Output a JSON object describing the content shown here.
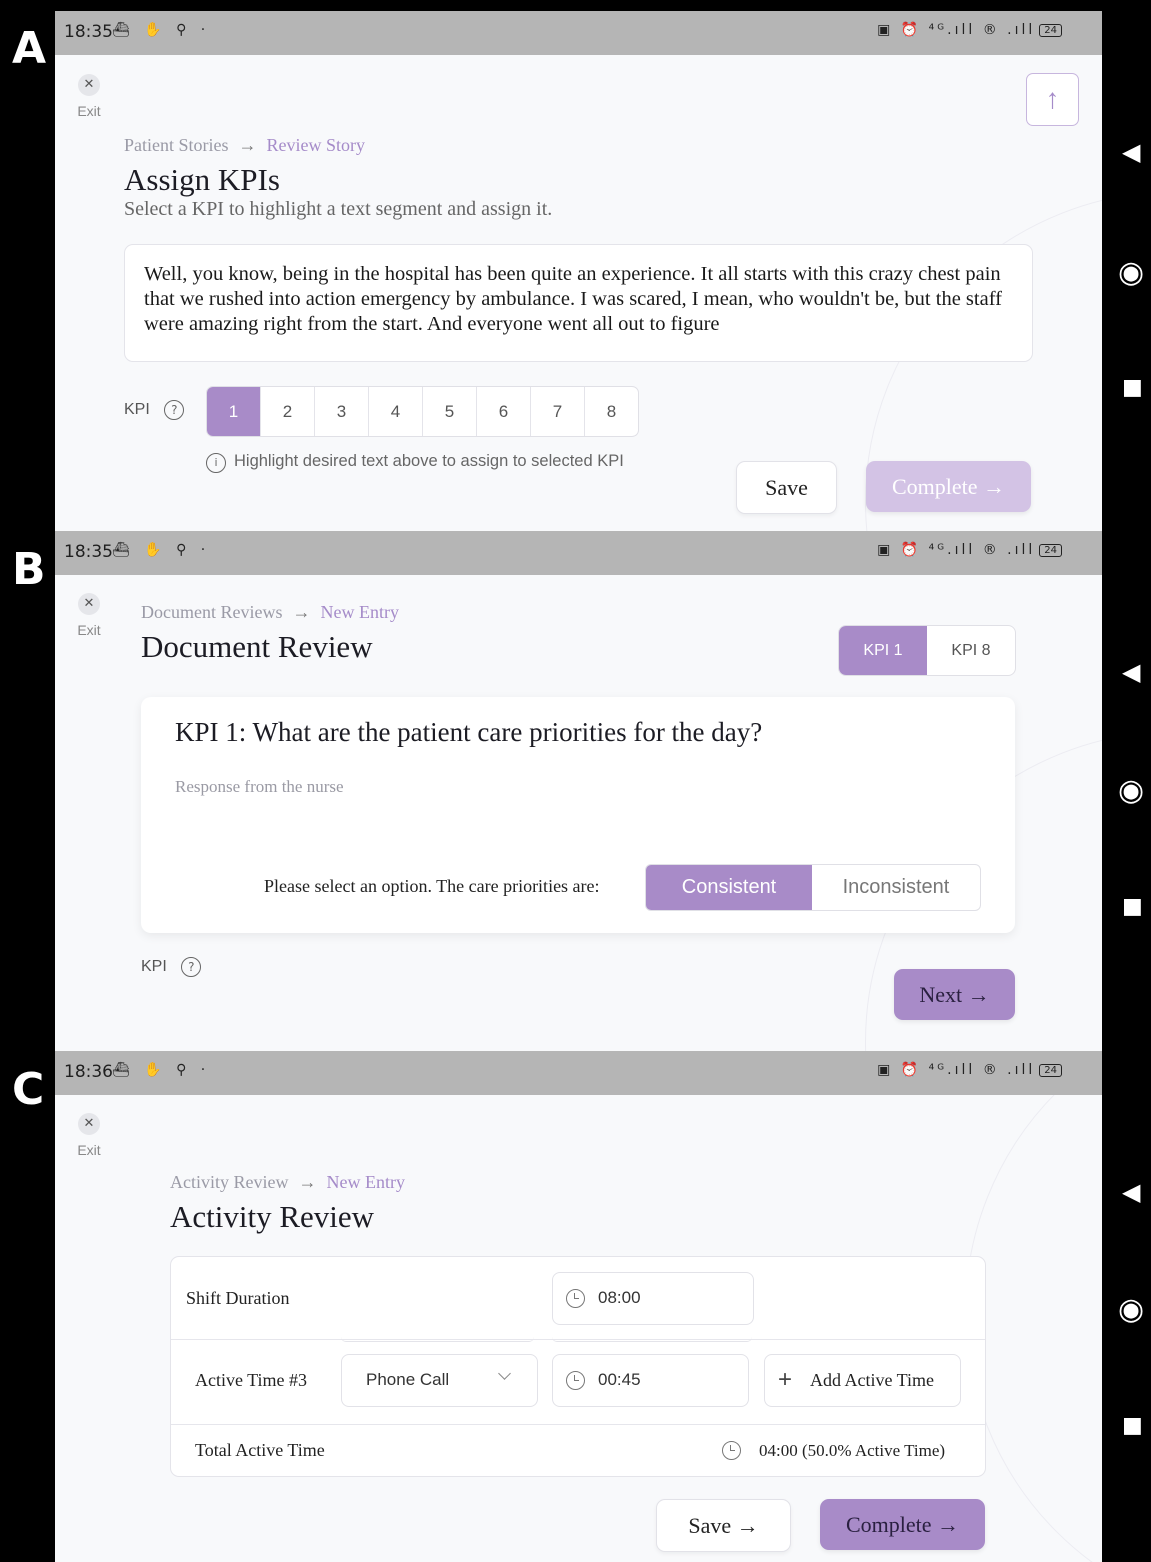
{
  "panels": {
    "a": {
      "letter": "A",
      "status": {
        "time": "18:35",
        "left_icons": "⛴ ✋ ⚲ ·",
        "right_icons": "▣ ⏰ ⁴ᴳ.ıll ® .ıll",
        "battery": "24"
      },
      "exit_label": "Exit",
      "breadcrumb": {
        "parent": "Patient Stories",
        "arrow": "→",
        "current": "Review Story"
      },
      "title": "Assign KPIs",
      "subtitle": "Select a KPI to highlight a text segment and assign it.",
      "story_text": "Well, you know, being in the hospital has been quite an experience. It all starts with this crazy chest pain that we rushed into action emergency by ambulance. I was scared, I mean, who wouldn't be, but the staff were amazing right from the start. And everyone went all out to figure",
      "kpi_label": "KPI",
      "help": "?",
      "kpi_options": [
        "1",
        "2",
        "3",
        "4",
        "5",
        "6",
        "7",
        "8"
      ],
      "selected_kpi": "1",
      "info_icon": "i",
      "hint": "Highlight desired text above to assign to selected KPI",
      "save_label": "Save",
      "complete_label": "Complete",
      "arrow": "→",
      "upload_arrow": "↑"
    },
    "b": {
      "letter": "B",
      "status": {
        "time": "18:35",
        "left_icons": "⛴ ✋ ⚲ ·",
        "right_icons": "▣ ⏰ ⁴ᴳ.ıll ® .ıll",
        "battery": "24"
      },
      "exit_label": "Exit",
      "breadcrumb": {
        "parent": "Document Reviews",
        "arrow": "→",
        "current": "New Entry"
      },
      "title": "Document Review",
      "tabs": [
        "KPI 1",
        "KPI 8"
      ],
      "question": "KPI 1: What are the patient care priorities for the day?",
      "response_placeholder": "Response from the nurse",
      "select_prompt": "Please select an option. The care priorities are:",
      "options": [
        "Consistent",
        "Inconsistent"
      ],
      "selected_option": "Consistent",
      "kpi_label": "KPI",
      "help": "?",
      "next_label": "Next",
      "arrow": "→"
    },
    "c": {
      "letter": "C",
      "status": {
        "time": "18:36",
        "left_icons": "⛴ ✋ ⚲ ·",
        "right_icons": "▣ ⏰ ⁴ᴳ.ıll ® .ıll",
        "battery": "24"
      },
      "exit_label": "Exit",
      "breadcrumb": {
        "parent": "Activity Review",
        "arrow": "→",
        "current": "New Entry"
      },
      "title": "Activity Review",
      "shift_label": "Shift Duration",
      "shift_value": "08:00",
      "active_label": "Active Time #3",
      "activity_type": "Phone Call",
      "active_value": "00:45",
      "add_active_label": "Add Active Time",
      "plus": "+",
      "total_label": "Total Active Time",
      "total_value": "04:00 (50.0% Active Time)",
      "save_label": "Save",
      "complete_label": "Complete",
      "arrow": "→"
    }
  },
  "nav": {
    "back": "◀",
    "home": "◉",
    "recent": "■"
  },
  "colors": {
    "accent": "#a88bc8",
    "accent_text": "#a58bc9",
    "statusbar": "#b5b5b5",
    "background": "#f8f9fb"
  }
}
